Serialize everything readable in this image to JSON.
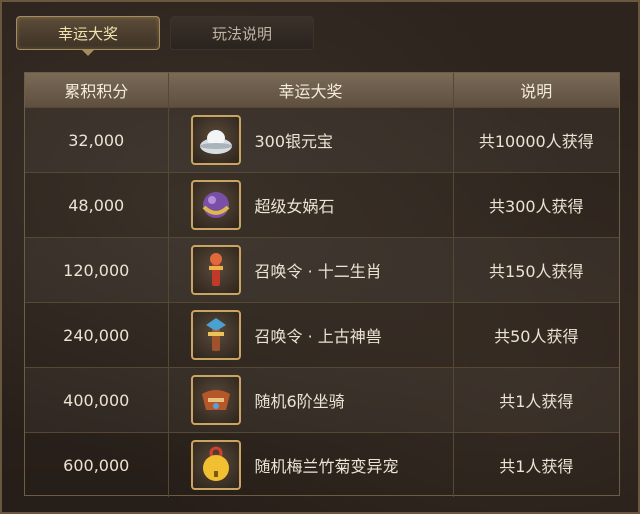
{
  "tabs": [
    {
      "label": "幸运大奖",
      "active": true
    },
    {
      "label": "玩法说明",
      "active": false
    }
  ],
  "table": {
    "headers": [
      "累积积分",
      "幸运大奖",
      "说明"
    ],
    "rows": [
      {
        "points": "32,000",
        "reward": "300银元宝",
        "desc": "共10000人获得",
        "icon": "silver-ingot-icon"
      },
      {
        "points": "48,000",
        "reward": "超级女娲石",
        "desc": "共300人获得",
        "icon": "nuwa-stone-icon"
      },
      {
        "points": "120,000",
        "reward": "召唤令 · 十二生肖",
        "desc": "共150人获得",
        "icon": "summon-token-zodiac-icon"
      },
      {
        "points": "240,000",
        "reward": "召唤令 · 上古神兽",
        "desc": "共50人获得",
        "icon": "summon-token-beast-icon"
      },
      {
        "points": "400,000",
        "reward": "随机6阶坐骑",
        "desc": "共1人获得",
        "icon": "mount-saddle-icon"
      },
      {
        "points": "600,000",
        "reward": "随机梅兰竹菊变异宠",
        "desc": "共1人获得",
        "icon": "pet-bell-icon"
      }
    ]
  },
  "colors": {
    "accent": "#c9a561",
    "text": "#ece3d3",
    "header_bg": "#6e5e4b"
  }
}
